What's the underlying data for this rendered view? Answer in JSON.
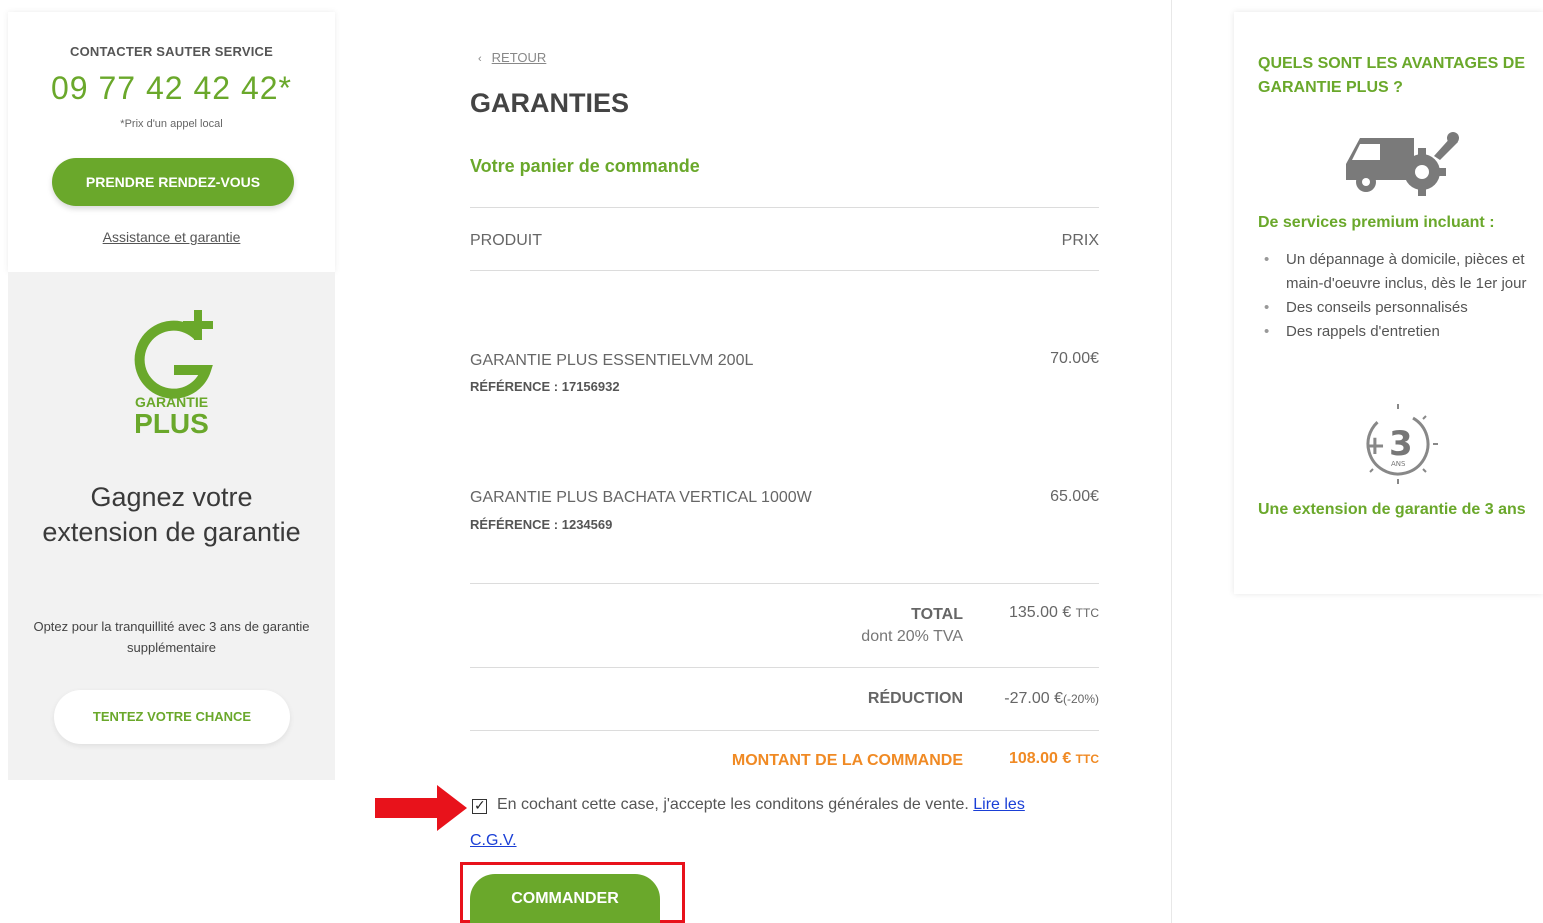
{
  "contact": {
    "label": "CONTACTER SAUTER SERVICE",
    "phone": "09 77 42 42 42*",
    "phone_note": "*Prix d'un appel local",
    "rdv_button": "PRENDRE RENDEZ-VOUS",
    "assist_link": "Assistance et garantie"
  },
  "promo": {
    "logo_line1": "GARANTIE",
    "logo_line2": "PLUS",
    "title": "Gagnez votre extension de garantie",
    "description": "Optez pour la tranquillité avec 3 ans de garantie supplémentaire",
    "button": "TENTEZ VOTRE CHANCE"
  },
  "main": {
    "back_label": "RETOUR",
    "title": "GARANTIES",
    "basket_title": "Votre panier de commande",
    "col_produit": "PRODUIT",
    "col_prix": "PRIX",
    "items": [
      {
        "name": "GARANTIE PLUS ESSENTIELVM 200L",
        "ref": "RÉFÉRENCE : 17156932",
        "price": "70.00€"
      },
      {
        "name": "GARANTIE PLUS BACHATA VERTICAL 1000W",
        "ref": "RÉFÉRENCE : 1234569",
        "price": "65.00€"
      }
    ],
    "total": {
      "label": "TOTAL",
      "sub": "dont 20% TVA",
      "value": "135.00 €",
      "suffix": "TTC"
    },
    "reduction": {
      "label": "RÉDUCTION",
      "value": "-27.00 €",
      "suffix": "(-20%)"
    },
    "order_amount": {
      "label": "MONTANT DE LA COMMANDE",
      "value": "108.00 €",
      "suffix": "TTC"
    },
    "cgv": {
      "checked": true,
      "text": "En cochant cette case, j'accepte les conditons générales de vente.",
      "link_part1": "Lire les",
      "link_part2": "C.G.V."
    },
    "order_button": "COMMANDER"
  },
  "advantages": {
    "title": "QUELS SONT LES AVANTAGES DE GARANTIE PLUS ?",
    "services_title": "De services premium incluant :",
    "services": [
      "Un dépannage à domicile, pièces et main-d'oeuvre inclus, dès le 1er jour",
      "Des conseils personnalisés",
      "Des rappels d'entretien"
    ],
    "badge_number": "3",
    "badge_unit": "ANS",
    "badge_plus": "+",
    "extension_text": "Une extension de garantie de 3 ans"
  },
  "colors": {
    "brand_green": "#6aa82b",
    "accent_orange": "#f08a24",
    "highlight_red": "#e8121b",
    "link_blue": "#1a3fd6"
  }
}
